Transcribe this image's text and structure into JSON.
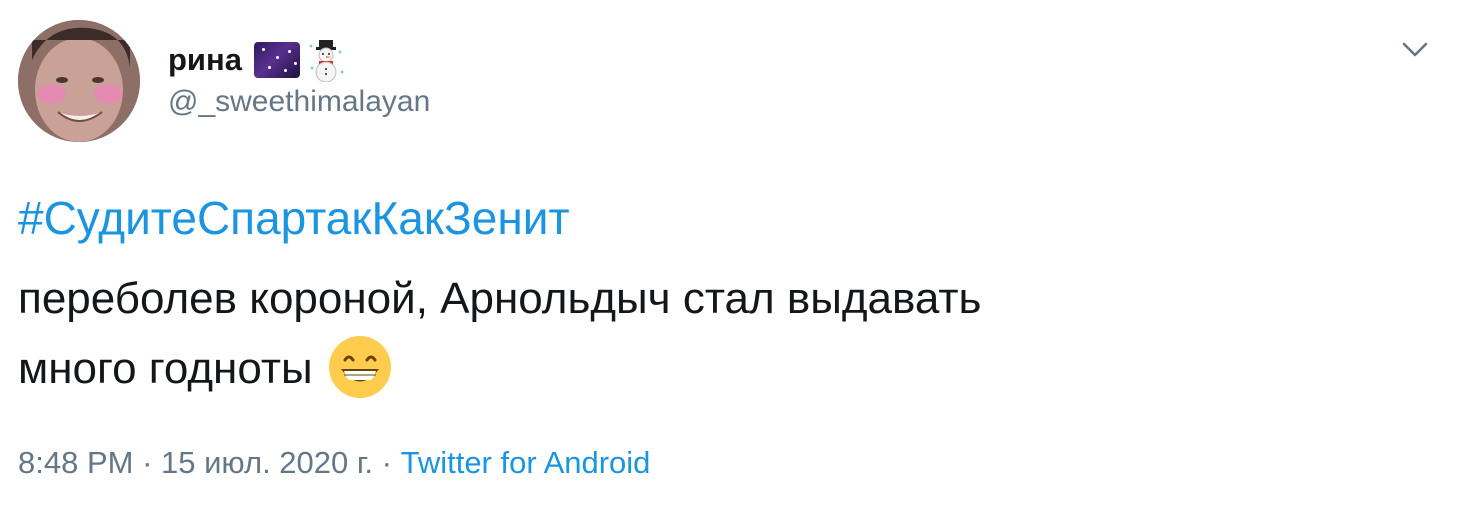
{
  "author": {
    "display_name": "рина",
    "name_emojis": [
      "galaxy-emoji",
      "snowman-emoji"
    ],
    "handle": "@_sweethimalayan"
  },
  "tweet": {
    "hashtag": "#СудитеСпартакКакЗенит",
    "text_line_1": "переболев короной, Арнольдыч стал выдавать",
    "text_line_2": "много годноты",
    "emoji": "grinning-face-with-smiling-eyes"
  },
  "meta": {
    "time": "8:48 PM",
    "separator_1": " · ",
    "date": "15 июл. 2020 г.",
    "separator_2": " · ",
    "source": "Twitter for Android"
  },
  "colors": {
    "link": "#1b95e0",
    "secondary": "#657786",
    "text": "#14171a"
  }
}
